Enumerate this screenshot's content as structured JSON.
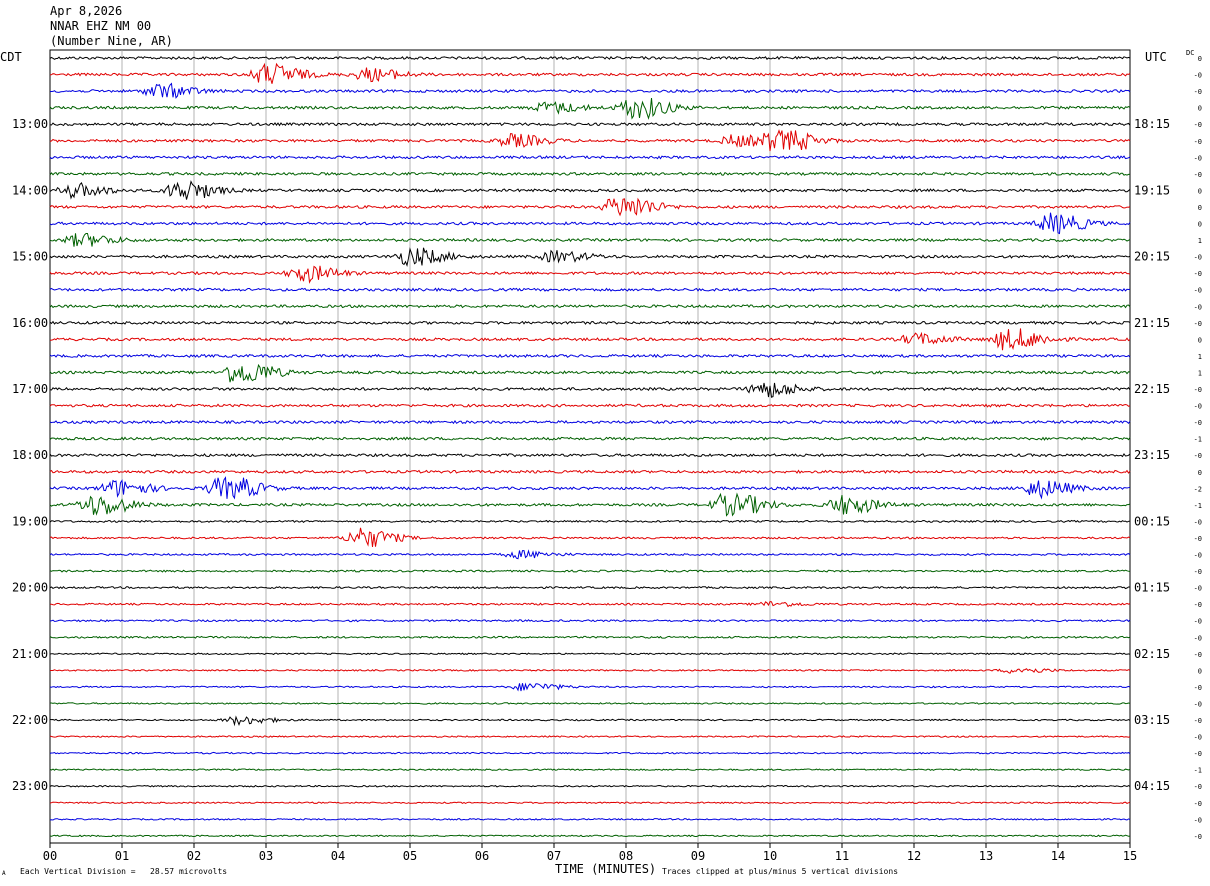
{
  "header": {
    "date": "Apr 8,2026",
    "station": "NNAR EHZ NM 00",
    "location": "(Number Nine, AR)"
  },
  "tz_left": "CDT",
  "tz_right": "UTC",
  "dc_label": "DC",
  "footer": {
    "scale_note": "Each Vertical Division =   28.57 microvolts",
    "clip_note": "Traces clipped at plus/minus 5 vertical divisions",
    "corner_mark": "A"
  },
  "chart_data": {
    "type": "line",
    "title": "",
    "xlabel": "TIME (MINUTES)",
    "ylabel": "",
    "xlim": [
      0,
      15
    ],
    "x_ticks": [
      "00",
      "01",
      "02",
      "03",
      "04",
      "05",
      "06",
      "07",
      "08",
      "09",
      "10",
      "11",
      "12",
      "13",
      "14",
      "15"
    ],
    "minutes_per_line": 15,
    "trace_colors": [
      "#000000",
      "#e00000",
      "#0000e0",
      "#006000"
    ],
    "left_labels": [
      "13:00",
      "14:00",
      "15:00",
      "16:00",
      "17:00",
      "18:00",
      "19:00",
      "20:00",
      "21:00",
      "22:00",
      "23:00"
    ],
    "right_labels": [
      "18:15",
      "19:15",
      "20:15",
      "21:15",
      "22:15",
      "23:15",
      "00:15",
      "01:15",
      "02:15",
      "03:15",
      "04:15"
    ],
    "first_labeled_line": 4,
    "line_count": 48,
    "dc_offsets": [
      "0",
      "-0",
      "-0",
      "0",
      "-0",
      "-0",
      "-0",
      "-0",
      "0",
      "0",
      "0",
      "1",
      "-0",
      "-0",
      "-0",
      "-0",
      "-0",
      "0",
      "1",
      "1",
      "-0",
      "-0",
      "-0",
      "-1",
      "-0",
      "0",
      "-2",
      "-1",
      "-0",
      "-0",
      "-0",
      "-0",
      "-0",
      "-0",
      "-0",
      "-0",
      "-0",
      "0",
      "-0",
      "-0",
      "-0",
      "-0",
      "-0",
      "-1",
      "-0",
      "-0",
      "-0",
      "-0"
    ],
    "events": [
      {
        "line": 1,
        "minute": 3.0,
        "amp": 2.6
      },
      {
        "line": 1,
        "minute": 4.4,
        "amp": 1.4
      },
      {
        "line": 2,
        "minute": 1.5,
        "amp": 1.6
      },
      {
        "line": 3,
        "minute": 8.1,
        "amp": 2.6
      },
      {
        "line": 3,
        "minute": 6.9,
        "amp": 1.2
      },
      {
        "line": 5,
        "minute": 10.1,
        "amp": 3.0
      },
      {
        "line": 5,
        "minute": 6.4,
        "amp": 1.4
      },
      {
        "line": 5,
        "minute": 9.5,
        "amp": 1.2
      },
      {
        "line": 8,
        "minute": 1.8,
        "amp": 2.3
      },
      {
        "line": 8,
        "minute": 0.3,
        "amp": 1.5
      },
      {
        "line": 9,
        "minute": 7.9,
        "amp": 3.0
      },
      {
        "line": 10,
        "minute": 13.9,
        "amp": 2.2
      },
      {
        "line": 11,
        "minute": 0.4,
        "amp": 1.4
      },
      {
        "line": 12,
        "minute": 5.0,
        "amp": 2.0
      },
      {
        "line": 12,
        "minute": 7.0,
        "amp": 1.2
      },
      {
        "line": 13,
        "minute": 3.5,
        "amp": 1.8
      },
      {
        "line": 17,
        "minute": 13.3,
        "amp": 2.6
      },
      {
        "line": 17,
        "minute": 12.0,
        "amp": 1.2
      },
      {
        "line": 19,
        "minute": 2.6,
        "amp": 3.0
      },
      {
        "line": 20,
        "minute": 9.9,
        "amp": 1.8
      },
      {
        "line": 26,
        "minute": 0.9,
        "amp": 1.8
      },
      {
        "line": 26,
        "minute": 2.4,
        "amp": 3.0
      },
      {
        "line": 26,
        "minute": 13.7,
        "amp": 1.9
      },
      {
        "line": 27,
        "minute": 0.6,
        "amp": 2.6
      },
      {
        "line": 27,
        "minute": 9.4,
        "amp": 3.0
      },
      {
        "line": 27,
        "minute": 11.0,
        "amp": 2.1
      },
      {
        "line": 29,
        "minute": 4.3,
        "amp": 2.3
      },
      {
        "line": 30,
        "minute": 6.5,
        "amp": 0.8
      },
      {
        "line": 33,
        "minute": 10.0,
        "amp": 0.5
      },
      {
        "line": 37,
        "minute": 13.4,
        "amp": 0.6
      },
      {
        "line": 38,
        "minute": 6.6,
        "amp": 0.9
      },
      {
        "line": 40,
        "minute": 2.6,
        "amp": 0.9
      }
    ]
  }
}
